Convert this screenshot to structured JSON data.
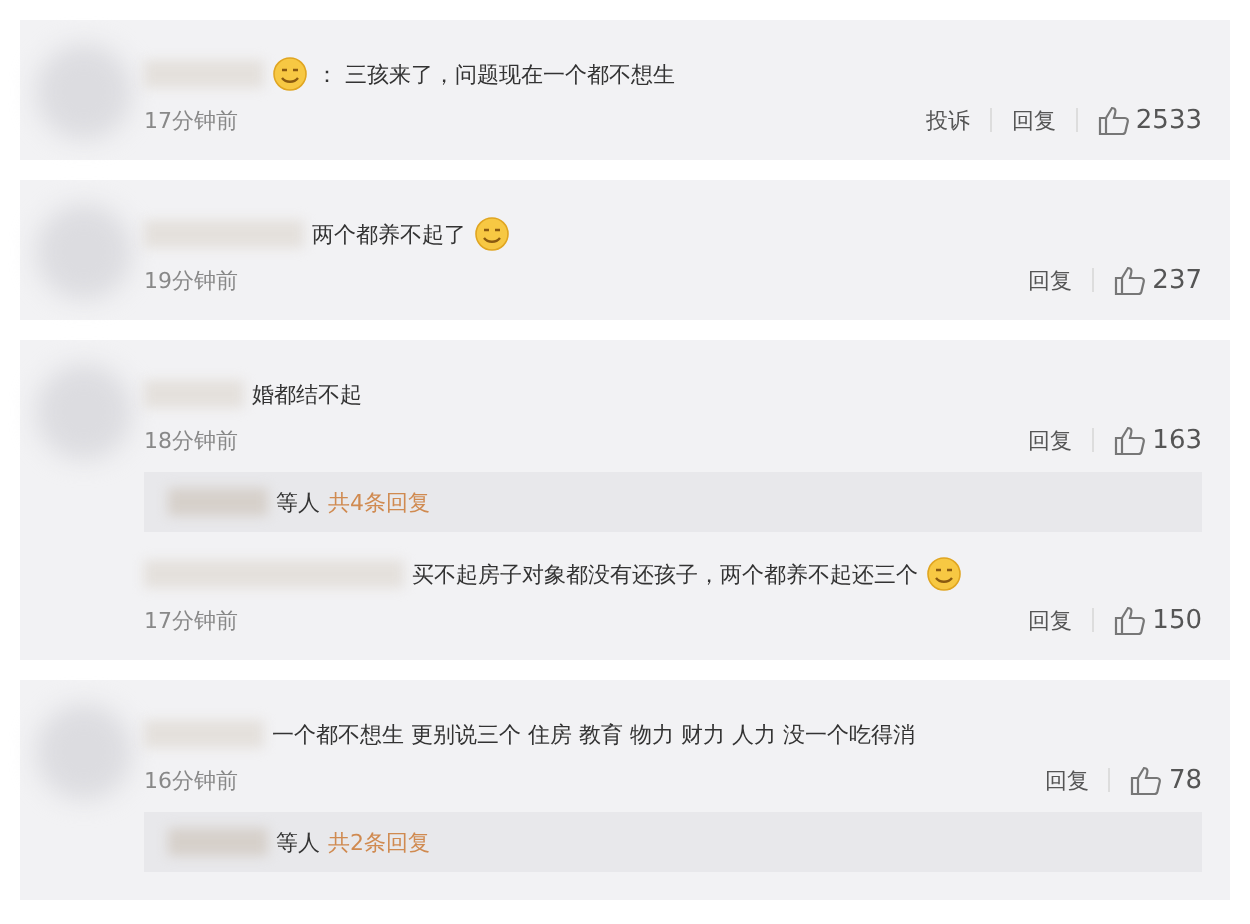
{
  "cards": [
    {
      "comments": [
        {
          "kind": "badge",
          "text": "：  三孩来了，问题现在一个都不想生",
          "time": "17分钟前",
          "actions": [
            "投诉",
            "回复"
          ],
          "likes": "2533"
        }
      ]
    },
    {
      "comments": [
        {
          "kind": "trailing",
          "text": "两个都养不起了",
          "time": "19分钟前",
          "actions": [
            "回复"
          ],
          "likes": "237"
        }
      ]
    },
    {
      "comments": [
        {
          "kind": "plain",
          "text": "婚都结不起",
          "time": "18分钟前",
          "actions": [
            "回复"
          ],
          "likes": "163",
          "reply_summary": {
            "suffix": "等人",
            "link": "共4条回复"
          }
        },
        {
          "kind": "trailing",
          "text": "买不起房子对象都没有还孩子，两个都养不起还三个",
          "time": "17分钟前",
          "actions": [
            "回复"
          ],
          "likes": "150"
        }
      ]
    },
    {
      "comments": [
        {
          "kind": "plain",
          "text": "一个都不想生  更别说三个  住房  教育    物力  财力   人力   没一个吃得消",
          "time": "16分钟前",
          "actions": [
            "回复"
          ],
          "likes": "78",
          "reply_summary": {
            "suffix": "等人",
            "link": "共2条回复"
          }
        }
      ]
    }
  ]
}
